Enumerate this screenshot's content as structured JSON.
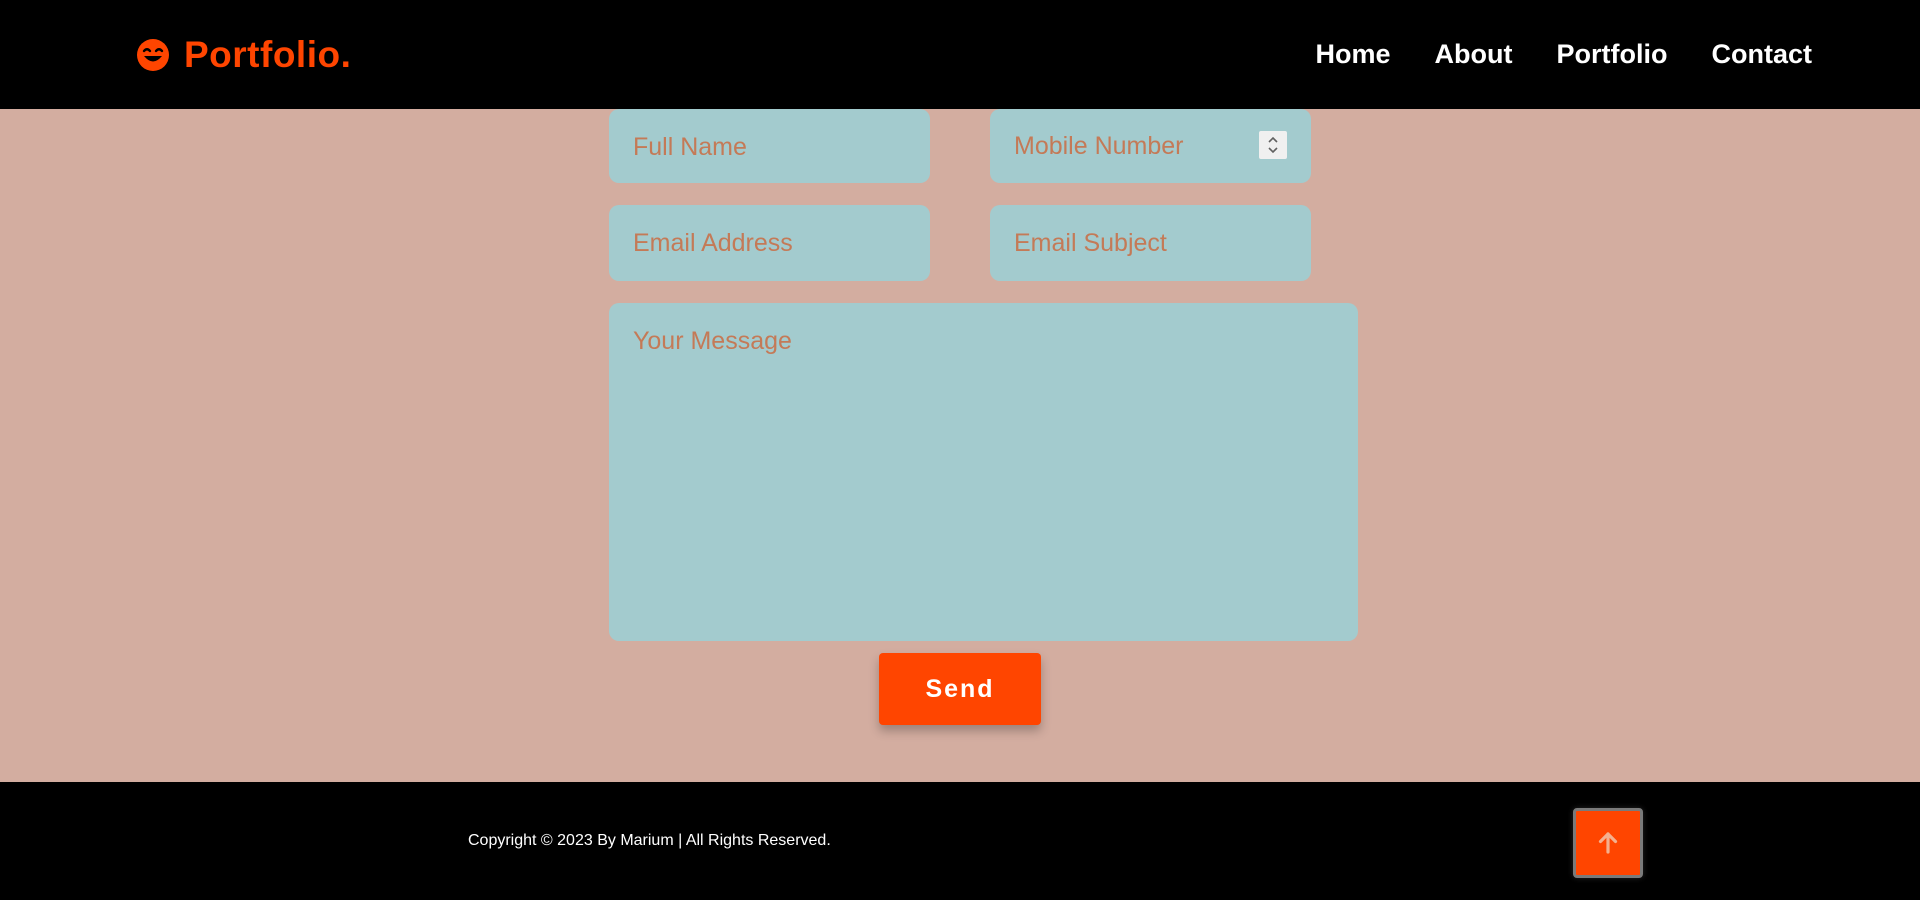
{
  "navbar": {
    "logo_text": "Portfolio.",
    "logo_icon": "smiling-face-icon",
    "links": [
      "Home",
      "About",
      "Portfolio",
      "Contact"
    ]
  },
  "form": {
    "full_name_placeholder": "Full Name",
    "mobile_placeholder": "Mobile Number",
    "email_placeholder": "Email Address",
    "subject_placeholder": "Email Subject",
    "message_placeholder": "Your Message",
    "send_label": "Send"
  },
  "footer": {
    "copyright": "Copyright © 2023 By Marium | All Rights Reserved.",
    "top_button_icon": "arrow-up-icon"
  },
  "colors": {
    "accent": "#ff4500",
    "background": "#d3ada0",
    "field_background": "#a3cbce",
    "placeholder": "#c47a57",
    "bar": "#000000"
  }
}
